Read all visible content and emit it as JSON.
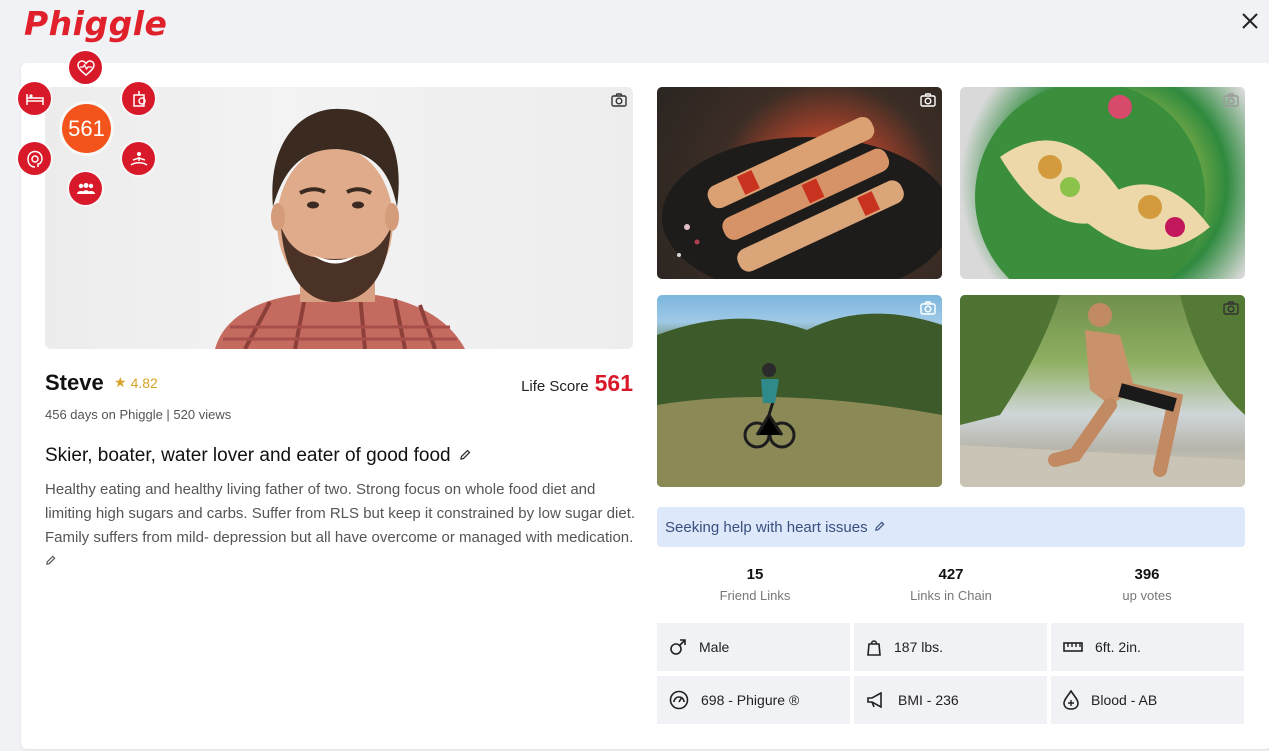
{
  "app": {
    "logo_text": "Phiggle",
    "accent_color": "#d8192a"
  },
  "score_wheel": {
    "score": "561",
    "icons": [
      "heart-pulse-icon",
      "bed-icon",
      "apple-icon",
      "brain-icon",
      "meditation-icon",
      "group-icon"
    ]
  },
  "profile": {
    "name": "Steve",
    "rating": "4.82",
    "life_score_label": "Life Score",
    "life_score": "561",
    "meta": "456 days on Phiggle | 520 views",
    "headline": "Skier, boater, water lover and eater of good food",
    "bio": "Healthy eating and healthy living father of two. Strong focus on whole food diet and limiting high sugars and carbs. Suffer from RLS but keep it constrained by low sugar diet. Family suffers from mild- depression but all have overcome or managed with medication."
  },
  "seeking": "Seeking help with heart issues",
  "stats": [
    {
      "value": "15",
      "label": "Friend Links"
    },
    {
      "value": "427",
      "label": "Links in Chain"
    },
    {
      "value": "396",
      "label": "up votes"
    }
  ],
  "tiles": [
    {
      "icon": "male-icon",
      "text": "Male"
    },
    {
      "icon": "weight-icon",
      "text": "187 lbs."
    },
    {
      "icon": "ruler-icon",
      "text": "6ft. 2in."
    },
    {
      "icon": "gauge-icon",
      "text": "698 - Phigure ®"
    },
    {
      "icon": "megaphone-icon",
      "text": "BMI - 236"
    },
    {
      "icon": "blood-drop-icon",
      "text": "Blood - AB"
    }
  ]
}
